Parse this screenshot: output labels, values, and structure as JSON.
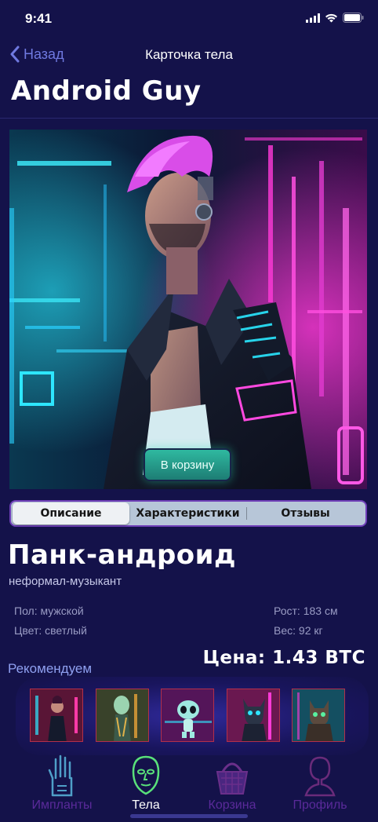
{
  "status_bar": {
    "time": "9:41"
  },
  "nav": {
    "back_label": "Назад",
    "title": "Карточка тела"
  },
  "page": {
    "title": "Android Guy"
  },
  "hero": {
    "image": "cyberpunk-android-portrait",
    "cart_button": "В корзину"
  },
  "tabs": [
    {
      "label": "Описание",
      "active": true
    },
    {
      "label": "Характеристики",
      "active": false
    },
    {
      "label": "Отзывы",
      "active": false
    }
  ],
  "product": {
    "name": "Панк-андроид",
    "subtitle": "неформал-музыкант",
    "specs": {
      "gender": "Пол: мужской",
      "color": "Цвет: светлый",
      "height": "Рост: 183 см",
      "weight": "Вес: 92 кг"
    },
    "price": "Цена: 1.43 BTC"
  },
  "recommendations": {
    "label": "Рекомендуем",
    "items": [
      "cyber-woman-thumbnail",
      "alien-android-thumbnail",
      "alien-robot-thumbnail",
      "robo-dog-thumbnail",
      "robo-cat-thumbnail"
    ]
  },
  "tab_bar": {
    "items": [
      {
        "label": "Импланты",
        "icon": "hand-implant-icon",
        "active": false
      },
      {
        "label": "Тела",
        "icon": "head-icon",
        "active": true
      },
      {
        "label": "Корзина",
        "icon": "basket-icon",
        "active": false
      },
      {
        "label": "Профиль",
        "icon": "profile-icon",
        "active": false
      }
    ]
  },
  "colors": {
    "background": "#14124a",
    "accent_blue": "#6f79e0",
    "tab_inactive": "#5a2a9a",
    "tab_active": "#ffffff",
    "cart_button": "#2fb9a0"
  }
}
